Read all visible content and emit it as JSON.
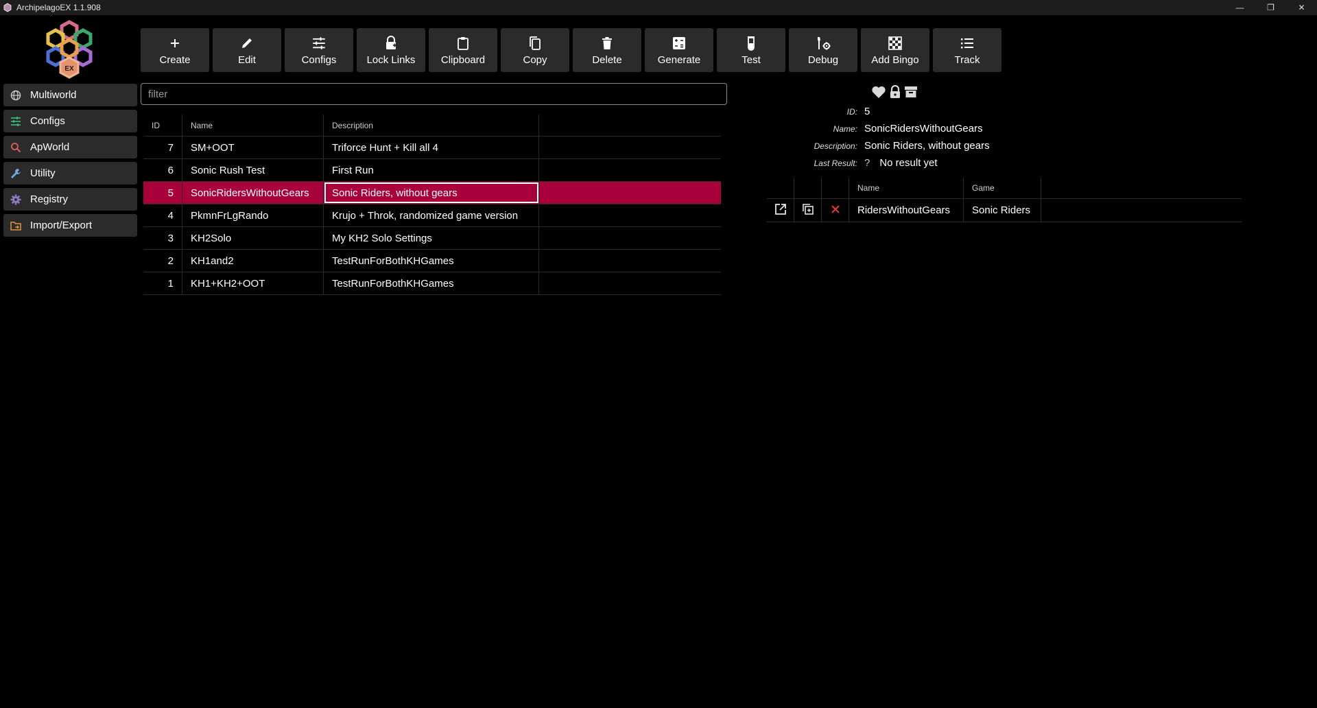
{
  "window": {
    "title": "ArchipelagoEX 1.1.908"
  },
  "sidebar": {
    "items": [
      {
        "label": "Multiworld",
        "icon": "globe-icon",
        "color": "#cccccc"
      },
      {
        "label": "Configs",
        "icon": "sliders-icon",
        "color": "#3fbf7f"
      },
      {
        "label": "ApWorld",
        "icon": "search-icon",
        "color": "#e06060"
      },
      {
        "label": "Utility",
        "icon": "wrench-icon",
        "color": "#6fa8dc"
      },
      {
        "label": "Registry",
        "icon": "gear-icon",
        "color": "#8e7cc3"
      },
      {
        "label": "Import/Export",
        "icon": "folder-export-icon",
        "color": "#e69138"
      }
    ]
  },
  "toolbar": {
    "buttons": [
      {
        "label": "Create",
        "icon": "plus-icon"
      },
      {
        "label": "Edit",
        "icon": "pencil-icon"
      },
      {
        "label": "Configs",
        "icon": "sliders-icon"
      },
      {
        "label": "Lock Links",
        "icon": "lock-plus-icon"
      },
      {
        "label": "Clipboard",
        "icon": "clipboard-icon"
      },
      {
        "label": "Copy",
        "icon": "copy-icon"
      },
      {
        "label": "Delete",
        "icon": "trash-icon"
      },
      {
        "label": "Generate",
        "icon": "calculator-icon"
      },
      {
        "label": "Test",
        "icon": "test-tube-icon"
      },
      {
        "label": "Debug",
        "icon": "tools-icon"
      },
      {
        "label": "Add Bingo",
        "icon": "checkerboard-icon"
      },
      {
        "label": "Track",
        "icon": "list-icon"
      }
    ]
  },
  "filter": {
    "placeholder": "filter",
    "value": ""
  },
  "table": {
    "columns": {
      "id": "ID",
      "name": "Name",
      "description": "Description"
    },
    "rows": [
      {
        "id": "7",
        "name": "SM+OOT",
        "description": "Triforce Hunt + Kill all 4"
      },
      {
        "id": "6",
        "name": "Sonic Rush Test",
        "description": "First Run"
      },
      {
        "id": "5",
        "name": "SonicRidersWithoutGears",
        "description": "Sonic Riders, without gears",
        "selected": true
      },
      {
        "id": "4",
        "name": "PkmnFrLgRando",
        "description": "Krujo + Throk, randomized game version"
      },
      {
        "id": "3",
        "name": "KH2Solo",
        "description": "My KH2 Solo Settings"
      },
      {
        "id": "2",
        "name": "KH1and2",
        "description": "TestRunForBothKHGames"
      },
      {
        "id": "1",
        "name": "KH1+KH2+OOT",
        "description": "TestRunForBothKHGames"
      }
    ]
  },
  "details": {
    "id_label": "ID:",
    "id": "5",
    "name_label": "Name:",
    "name": "SonicRidersWithoutGears",
    "description_label": "Description:",
    "description": "Sonic Riders, without gears",
    "last_result_label": "Last Result:",
    "last_result_icon": "?",
    "last_result": "No result yet"
  },
  "games_table": {
    "columns": {
      "name": "Name",
      "game": "Game"
    },
    "rows": [
      {
        "name": "RidersWithoutGears",
        "game": "Sonic Riders"
      }
    ]
  },
  "colors": {
    "accent": "#a8003b",
    "panel": "#2b2b2b",
    "delete": "#e53935"
  }
}
